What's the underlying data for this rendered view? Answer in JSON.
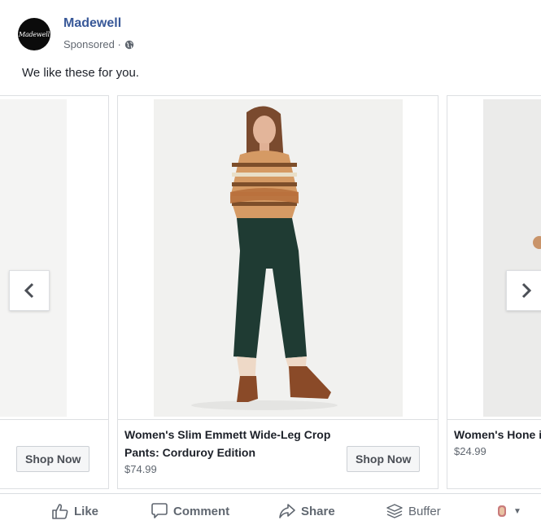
{
  "post": {
    "page_name": "Madewell",
    "avatar_text": "Madewell",
    "sponsored": "Sponsored ·",
    "text": "We like these for you."
  },
  "carousel": {
    "cards": [
      {
        "title": "",
        "price": "",
        "button": "Shop Now"
      },
      {
        "title": "Women's Slim Emmett Wide-Leg Crop Pants: Corduroy Edition",
        "price": "$74.99",
        "button": "Shop Now"
      },
      {
        "title": "Women's Hone in Kasson Stri",
        "price": "$24.99",
        "button": ""
      }
    ]
  },
  "actions": {
    "like": "Like",
    "comment": "Comment",
    "share": "Share",
    "buffer": "Buffer"
  },
  "colors": {
    "link_blue": "#385898",
    "text_gray": "#606770",
    "border": "#dddfe2",
    "pants_green": "#1f3b33",
    "boots_brown": "#8a4a28"
  },
  "icons": [
    "globe-icon",
    "chevron-left-icon",
    "chevron-right-icon",
    "thumbs-up-icon",
    "comment-icon",
    "share-icon",
    "buffer-icon",
    "reaction-icon"
  ]
}
